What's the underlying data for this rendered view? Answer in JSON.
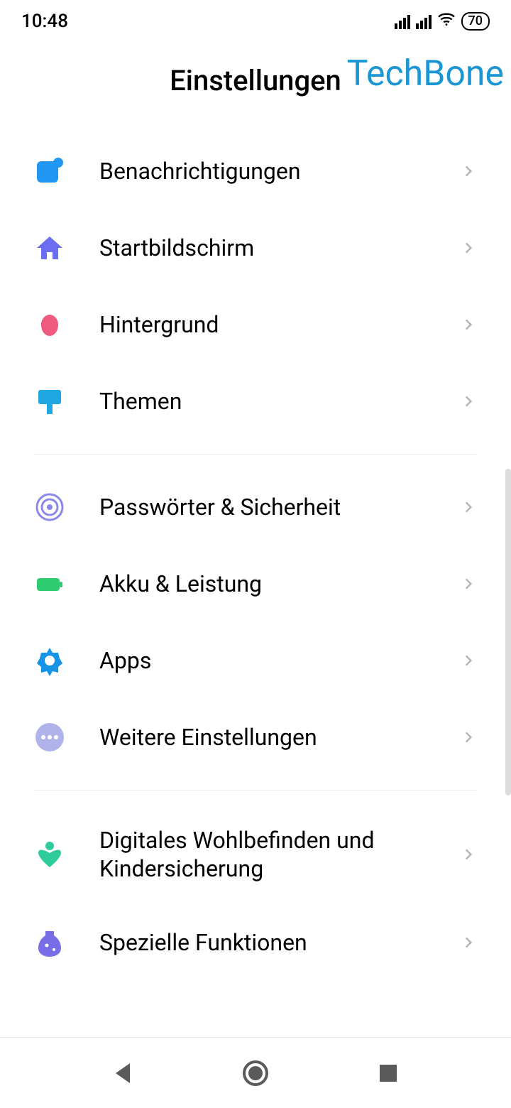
{
  "status": {
    "time": "10:48",
    "battery": "70"
  },
  "header": {
    "title": "Einstellungen",
    "watermark": "TechBone"
  },
  "groups": [
    {
      "items": [
        {
          "icon": "notifications",
          "label": "Benachrichtigungen",
          "color": "#2196f3"
        },
        {
          "icon": "home",
          "label": "Startbildschirm",
          "color": "#6b6ef0"
        },
        {
          "icon": "wallpaper",
          "label": "Hintergrund",
          "color": "#f05a7e"
        },
        {
          "icon": "themes",
          "label": "Themen",
          "color": "#1ea7e0"
        }
      ]
    },
    {
      "items": [
        {
          "icon": "security",
          "label": "Passwörter & Sicherheit",
          "color": "#8b89e8"
        },
        {
          "icon": "battery",
          "label": "Akku & Leistung",
          "color": "#2ecc71"
        },
        {
          "icon": "apps",
          "label": "Apps",
          "color": "#1593e6"
        },
        {
          "icon": "more",
          "label": "Weitere Einstellungen",
          "color": "#b0b3ea"
        }
      ]
    },
    {
      "items": [
        {
          "icon": "wellbeing",
          "label": "Digitales Wohlbefinden und Kindersicherung",
          "color": "#2ecc9a"
        },
        {
          "icon": "special",
          "label": "Spezielle Funktionen",
          "color": "#7a6ee8"
        }
      ]
    }
  ]
}
